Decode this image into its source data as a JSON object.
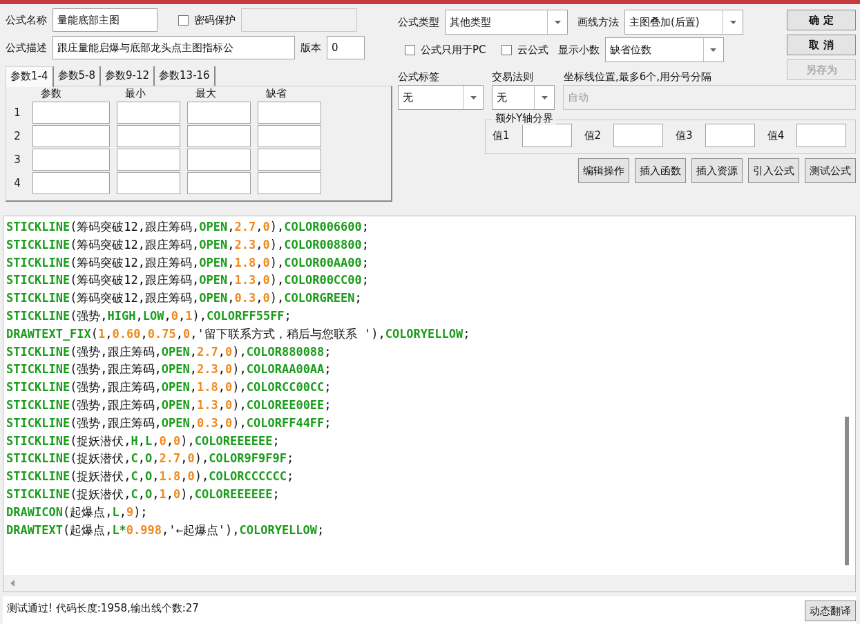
{
  "formula": {
    "name_label": "公式名称",
    "name": "量能底部主图",
    "password": {
      "label": "密码保护",
      "checked": false,
      "field_disabled": true
    },
    "desc_label": "公式描述",
    "description": "跟庄量能启爆与底部龙头点主图指标公",
    "version_label": "版本",
    "version": "0"
  },
  "param_tabs": [
    {
      "label": "参数1-4",
      "selected": true
    },
    {
      "label": "参数5-8",
      "selected": false
    },
    {
      "label": "参数9-12",
      "selected": false
    },
    {
      "label": "参数13-16",
      "selected": false
    }
  ],
  "param_columns": [
    "参数",
    "最小",
    "最大",
    "缺省"
  ],
  "param_rows": [
    "1",
    "2",
    "3",
    "4"
  ],
  "settings": {
    "type_label": "公式类型",
    "type": "其他类型",
    "draw_label": "画线方法",
    "draw": "主图叠加(后置)",
    "pc_only": {
      "label": "公式只用于PC",
      "checked": false
    },
    "cloud": {
      "label": "云公式",
      "checked": false
    },
    "decimals_label": "显示小数",
    "decimals": "缺省位数"
  },
  "side_buttons": [
    {
      "label": "确 定",
      "disabled": false
    },
    {
      "label": "取 消",
      "disabled": false
    },
    {
      "label": "另存为",
      "disabled": true
    }
  ],
  "tag": {
    "label": "公式标签",
    "value": "无"
  },
  "rule": {
    "label": "交易法则",
    "value": "无"
  },
  "axis": {
    "label": "坐标线位置,最多6个,用分号分隔",
    "placeholder": "自动",
    "disabled": true
  },
  "y_bounds": {
    "legend": "额外Y轴分界",
    "values": [
      "值1",
      "值2",
      "值3",
      "值4"
    ]
  },
  "tool_buttons": [
    "编辑操作",
    "插入函数",
    "插入资源",
    "引入公式",
    "测试公式"
  ],
  "code_lines": [
    [
      {
        "kind": "w",
        "text": "STICKLINE"
      },
      {
        "kind": "p",
        "text": "(筹码突破12,跟庄筹码,"
      },
      {
        "kind": "w",
        "text": "OPEN"
      },
      {
        "kind": "p",
        "text": ","
      },
      {
        "kind": "n",
        "text": "2.7"
      },
      {
        "kind": "p",
        "text": ","
      },
      {
        "kind": "n",
        "text": "0"
      },
      {
        "kind": "p",
        "text": "),"
      },
      {
        "kind": "w",
        "text": "COLOR006600"
      },
      {
        "kind": "p",
        "text": ";"
      }
    ],
    [
      {
        "kind": "w",
        "text": "STICKLINE"
      },
      {
        "kind": "p",
        "text": "(筹码突破12,跟庄筹码,"
      },
      {
        "kind": "w",
        "text": "OPEN"
      },
      {
        "kind": "p",
        "text": ","
      },
      {
        "kind": "n",
        "text": "2.3"
      },
      {
        "kind": "p",
        "text": ","
      },
      {
        "kind": "n",
        "text": "0"
      },
      {
        "kind": "p",
        "text": "),"
      },
      {
        "kind": "w",
        "text": "COLOR008800"
      },
      {
        "kind": "p",
        "text": ";"
      }
    ],
    [
      {
        "kind": "w",
        "text": "STICKLINE"
      },
      {
        "kind": "p",
        "text": "(筹码突破12,跟庄筹码,"
      },
      {
        "kind": "w",
        "text": "OPEN"
      },
      {
        "kind": "p",
        "text": ","
      },
      {
        "kind": "n",
        "text": "1.8"
      },
      {
        "kind": "p",
        "text": ","
      },
      {
        "kind": "n",
        "text": "0"
      },
      {
        "kind": "p",
        "text": "),"
      },
      {
        "kind": "w",
        "text": "COLOR00AA00"
      },
      {
        "kind": "p",
        "text": ";"
      }
    ],
    [
      {
        "kind": "w",
        "text": "STICKLINE"
      },
      {
        "kind": "p",
        "text": "(筹码突破12,跟庄筹码,"
      },
      {
        "kind": "w",
        "text": "OPEN"
      },
      {
        "kind": "p",
        "text": ","
      },
      {
        "kind": "n",
        "text": "1.3"
      },
      {
        "kind": "p",
        "text": ","
      },
      {
        "kind": "n",
        "text": "0"
      },
      {
        "kind": "p",
        "text": "),"
      },
      {
        "kind": "w",
        "text": "COLOR00CC00"
      },
      {
        "kind": "p",
        "text": ";"
      }
    ],
    [
      {
        "kind": "w",
        "text": "STICKLINE"
      },
      {
        "kind": "p",
        "text": "(筹码突破12,跟庄筹码,"
      },
      {
        "kind": "w",
        "text": "OPEN"
      },
      {
        "kind": "p",
        "text": ","
      },
      {
        "kind": "n",
        "text": "0.3"
      },
      {
        "kind": "p",
        "text": ","
      },
      {
        "kind": "n",
        "text": "0"
      },
      {
        "kind": "p",
        "text": "),"
      },
      {
        "kind": "w",
        "text": "COLORGREEN"
      },
      {
        "kind": "p",
        "text": ";"
      }
    ],
    [
      {
        "kind": "w",
        "text": "STICKLINE"
      },
      {
        "kind": "p",
        "text": "(强势,"
      },
      {
        "kind": "w",
        "text": "HIGH"
      },
      {
        "kind": "p",
        "text": ","
      },
      {
        "kind": "w",
        "text": "LOW"
      },
      {
        "kind": "p",
        "text": ","
      },
      {
        "kind": "n",
        "text": "0"
      },
      {
        "kind": "p",
        "text": ","
      },
      {
        "kind": "n",
        "text": "1"
      },
      {
        "kind": "p",
        "text": "),"
      },
      {
        "kind": "w",
        "text": "COLORFF55FF"
      },
      {
        "kind": "p",
        "text": ";"
      }
    ],
    [
      {
        "kind": "w",
        "text": "DRAWTEXT_FIX"
      },
      {
        "kind": "p",
        "text": "("
      },
      {
        "kind": "n",
        "text": "1"
      },
      {
        "kind": "p",
        "text": ","
      },
      {
        "kind": "n",
        "text": "0.60"
      },
      {
        "kind": "p",
        "text": ","
      },
      {
        "kind": "n",
        "text": "0.75"
      },
      {
        "kind": "p",
        "text": ","
      },
      {
        "kind": "n",
        "text": "0"
      },
      {
        "kind": "p",
        "text": ",'留下联系方式，稍后与您联系 '),"
      },
      {
        "kind": "w",
        "text": "COLORYELLOW"
      },
      {
        "kind": "p",
        "text": ";"
      }
    ],
    [
      {
        "kind": "w",
        "text": "STICKLINE"
      },
      {
        "kind": "p",
        "text": "(强势,跟庄筹码,"
      },
      {
        "kind": "w",
        "text": "OPEN"
      },
      {
        "kind": "p",
        "text": ","
      },
      {
        "kind": "n",
        "text": "2.7"
      },
      {
        "kind": "p",
        "text": ","
      },
      {
        "kind": "n",
        "text": "0"
      },
      {
        "kind": "p",
        "text": "),"
      },
      {
        "kind": "w",
        "text": "COLOR880088"
      },
      {
        "kind": "p",
        "text": ";"
      }
    ],
    [
      {
        "kind": "w",
        "text": "STICKLINE"
      },
      {
        "kind": "p",
        "text": "(强势,跟庄筹码,"
      },
      {
        "kind": "w",
        "text": "OPEN"
      },
      {
        "kind": "p",
        "text": ","
      },
      {
        "kind": "n",
        "text": "2.3"
      },
      {
        "kind": "p",
        "text": ","
      },
      {
        "kind": "n",
        "text": "0"
      },
      {
        "kind": "p",
        "text": "),"
      },
      {
        "kind": "w",
        "text": "COLORAA00AA"
      },
      {
        "kind": "p",
        "text": ";"
      }
    ],
    [
      {
        "kind": "w",
        "text": "STICKLINE"
      },
      {
        "kind": "p",
        "text": "(强势,跟庄筹码,"
      },
      {
        "kind": "w",
        "text": "OPEN"
      },
      {
        "kind": "p",
        "text": ","
      },
      {
        "kind": "n",
        "text": "1.8"
      },
      {
        "kind": "p",
        "text": ","
      },
      {
        "kind": "n",
        "text": "0"
      },
      {
        "kind": "p",
        "text": "),"
      },
      {
        "kind": "w",
        "text": "COLORCC00CC"
      },
      {
        "kind": "p",
        "text": ";"
      }
    ],
    [
      {
        "kind": "w",
        "text": "STICKLINE"
      },
      {
        "kind": "p",
        "text": "(强势,跟庄筹码,"
      },
      {
        "kind": "w",
        "text": "OPEN"
      },
      {
        "kind": "p",
        "text": ","
      },
      {
        "kind": "n",
        "text": "1.3"
      },
      {
        "kind": "p",
        "text": ","
      },
      {
        "kind": "n",
        "text": "0"
      },
      {
        "kind": "p",
        "text": "),"
      },
      {
        "kind": "w",
        "text": "COLOREE00EE"
      },
      {
        "kind": "p",
        "text": ";"
      }
    ],
    [
      {
        "kind": "w",
        "text": "STICKLINE"
      },
      {
        "kind": "p",
        "text": "(强势,跟庄筹码,"
      },
      {
        "kind": "w",
        "text": "OPEN"
      },
      {
        "kind": "p",
        "text": ","
      },
      {
        "kind": "n",
        "text": "0.3"
      },
      {
        "kind": "p",
        "text": ","
      },
      {
        "kind": "n",
        "text": "0"
      },
      {
        "kind": "p",
        "text": "),"
      },
      {
        "kind": "w",
        "text": "COLORFF44FF"
      },
      {
        "kind": "p",
        "text": ";"
      }
    ],
    [
      {
        "kind": "w",
        "text": "STICKLINE"
      },
      {
        "kind": "p",
        "text": "(捉妖潜伏,"
      },
      {
        "kind": "w",
        "text": "H"
      },
      {
        "kind": "p",
        "text": ","
      },
      {
        "kind": "w",
        "text": "L"
      },
      {
        "kind": "p",
        "text": ","
      },
      {
        "kind": "n",
        "text": "0"
      },
      {
        "kind": "p",
        "text": ","
      },
      {
        "kind": "n",
        "text": "0"
      },
      {
        "kind": "p",
        "text": "),"
      },
      {
        "kind": "w",
        "text": "COLOREEEEEE"
      },
      {
        "kind": "p",
        "text": ";"
      }
    ],
    [
      {
        "kind": "w",
        "text": "STICKLINE"
      },
      {
        "kind": "p",
        "text": "(捉妖潜伏,"
      },
      {
        "kind": "w",
        "text": "C"
      },
      {
        "kind": "p",
        "text": ","
      },
      {
        "kind": "w",
        "text": "O"
      },
      {
        "kind": "p",
        "text": ","
      },
      {
        "kind": "n",
        "text": "2.7"
      },
      {
        "kind": "p",
        "text": ","
      },
      {
        "kind": "n",
        "text": "0"
      },
      {
        "kind": "p",
        "text": "),"
      },
      {
        "kind": "w",
        "text": "COLOR9F9F9F"
      },
      {
        "kind": "p",
        "text": ";"
      }
    ],
    [
      {
        "kind": "w",
        "text": "STICKLINE"
      },
      {
        "kind": "p",
        "text": "(捉妖潜伏,"
      },
      {
        "kind": "w",
        "text": "C"
      },
      {
        "kind": "p",
        "text": ","
      },
      {
        "kind": "w",
        "text": "O"
      },
      {
        "kind": "p",
        "text": ","
      },
      {
        "kind": "n",
        "text": "1.8"
      },
      {
        "kind": "p",
        "text": ","
      },
      {
        "kind": "n",
        "text": "0"
      },
      {
        "kind": "p",
        "text": "),"
      },
      {
        "kind": "w",
        "text": "COLORCCCCCC"
      },
      {
        "kind": "p",
        "text": ";"
      }
    ],
    [
      {
        "kind": "w",
        "text": "STICKLINE"
      },
      {
        "kind": "p",
        "text": "(捉妖潜伏,"
      },
      {
        "kind": "w",
        "text": "C"
      },
      {
        "kind": "p",
        "text": ","
      },
      {
        "kind": "w",
        "text": "O"
      },
      {
        "kind": "p",
        "text": ","
      },
      {
        "kind": "n",
        "text": "1"
      },
      {
        "kind": "p",
        "text": ","
      },
      {
        "kind": "n",
        "text": "0"
      },
      {
        "kind": "p",
        "text": "),"
      },
      {
        "kind": "w",
        "text": "COLOREEEEEE"
      },
      {
        "kind": "p",
        "text": ";"
      }
    ],
    [
      {
        "kind": "w",
        "text": "DRAWICON"
      },
      {
        "kind": "p",
        "text": "(起爆点,"
      },
      {
        "kind": "w",
        "text": "L"
      },
      {
        "kind": "p",
        "text": ","
      },
      {
        "kind": "n",
        "text": "9"
      },
      {
        "kind": "p",
        "text": ");"
      }
    ],
    [
      {
        "kind": "w",
        "text": "DRAWTEXT"
      },
      {
        "kind": "p",
        "text": "(起爆点,"
      },
      {
        "kind": "w",
        "text": "L*"
      },
      {
        "kind": "n",
        "text": "0.998"
      },
      {
        "kind": "p",
        "text": ",'←起爆点'),"
      },
      {
        "kind": "w",
        "text": "COLORYELLOW"
      },
      {
        "kind": "p",
        "text": ";"
      }
    ]
  ],
  "status": {
    "message": "测试通过! 代码长度:1958,输出线个数:27",
    "button": "动态翻译"
  }
}
